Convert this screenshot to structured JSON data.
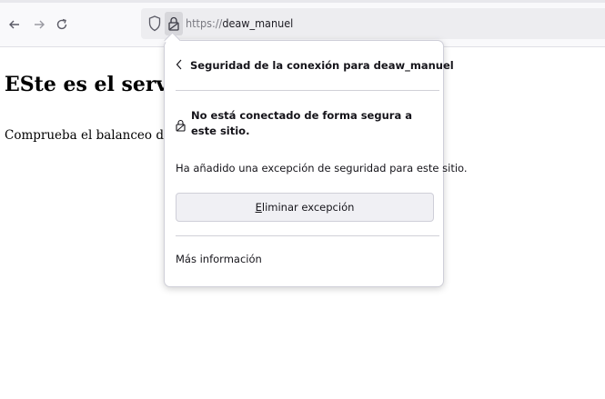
{
  "toolbar": {
    "back_icon": "arrow-left-icon",
    "forward_icon": "arrow-right-icon",
    "reload_icon": "reload-icon",
    "url_scheme": "https://",
    "url_host": "deaw_manuel"
  },
  "page": {
    "heading": "ESte es el servidor",
    "paragraph": "Comprueba el balanceo de carga"
  },
  "security_panel": {
    "back_icon": "chevron-left-icon",
    "title": "Seguridad de la conexión para deaw_manuel",
    "warning": "No está conectado de forma segura a este sitio.",
    "exception_note": "Ha añadido una excepción de seguridad para este sitio.",
    "remove_button_mnemonic": "E",
    "remove_button_rest": "liminar excepción",
    "more_info_link": "Más información"
  },
  "colors": {
    "toolbar_bg": "#f9f9fb",
    "urlbar_bg": "#ededf0",
    "panel_border": "#cfcfd8",
    "text": "#15141a"
  }
}
